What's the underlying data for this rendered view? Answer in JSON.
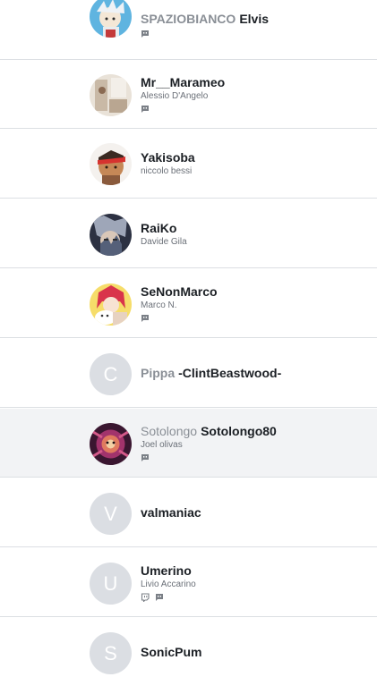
{
  "users": [
    {
      "prefix": "SPAZIOBIANCO",
      "name": "Elvis",
      "real_name": "",
      "avatar_letter": "",
      "icons": [
        "discord-icon"
      ]
    },
    {
      "prefix": "",
      "name": "Mr__Marameo",
      "real_name": "Alessio D'Angelo",
      "avatar_letter": "",
      "icons": [
        "discord-icon"
      ]
    },
    {
      "prefix": "",
      "name": "Yakisoba",
      "real_name": "niccolo bessi",
      "avatar_letter": "",
      "icons": []
    },
    {
      "prefix": "",
      "name": "RaiKo",
      "real_name": "Davide Gila",
      "avatar_letter": "",
      "icons": []
    },
    {
      "prefix": "",
      "name": "SeNonMarco",
      "real_name": "Marco N.",
      "avatar_letter": "",
      "icons": [
        "discord-icon"
      ]
    },
    {
      "prefix": "Pippa",
      "name": "-ClintBeastwood-",
      "real_name": "",
      "avatar_letter": "C",
      "icons": []
    },
    {
      "prefix": "Sotolongo",
      "name": "Sotolongo80",
      "real_name": "Joel olivas",
      "avatar_letter": "",
      "icons": [
        "discord-icon"
      ]
    },
    {
      "prefix": "",
      "name": "valmaniac",
      "real_name": "",
      "avatar_letter": "V",
      "icons": []
    },
    {
      "prefix": "",
      "name": "Umerino",
      "real_name": "Livio Accarino",
      "avatar_letter": "U",
      "icons": [
        "twitch-icon",
        "discord-icon"
      ]
    },
    {
      "prefix": "",
      "name": "SonicPum",
      "real_name": "",
      "avatar_letter": "S",
      "icons": []
    }
  ],
  "colors": {
    "divider": "#dcdfe3",
    "highlight_row": "#f2f3f5",
    "letter_avatar_bg": "#dbdee3",
    "name_text": "#1b1f24",
    "prefix_text": "#8a8f96",
    "sub_text": "#6b7078",
    "icon_color": "#7a7f86"
  }
}
